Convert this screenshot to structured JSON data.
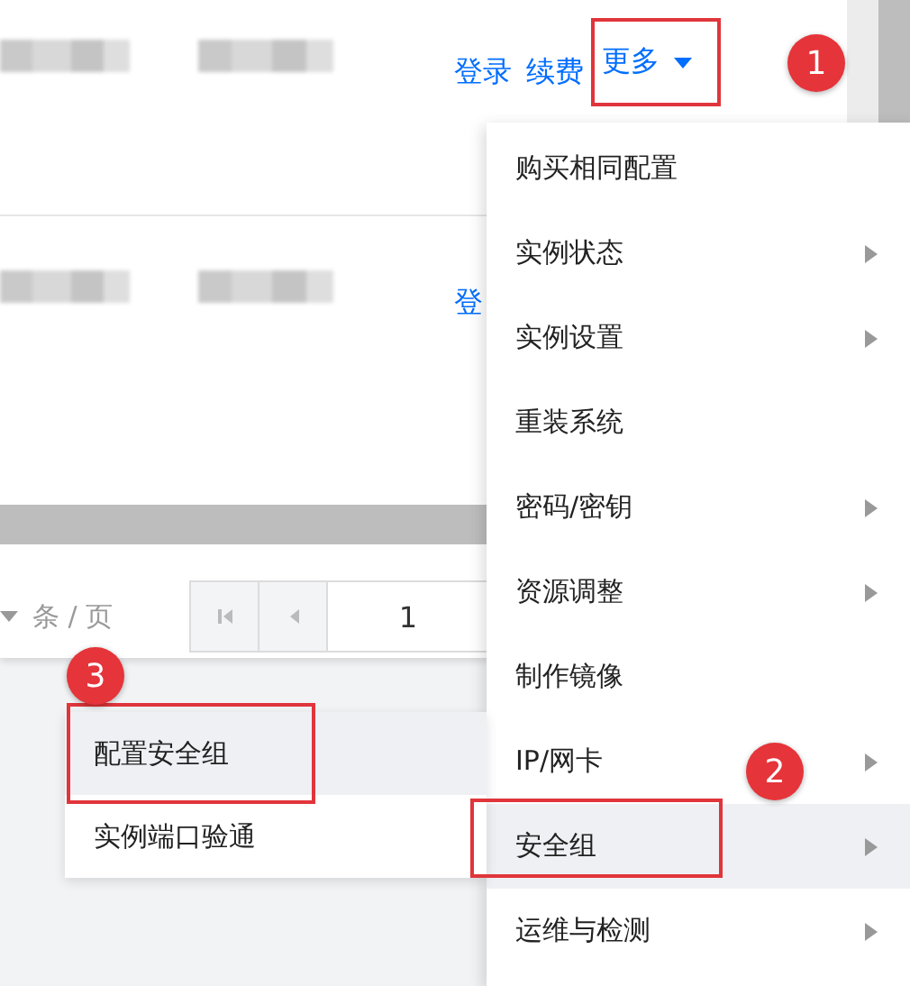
{
  "table": {
    "rows": [
      {
        "actions": [
          {
            "label": "登录"
          },
          {
            "label": "续费"
          }
        ],
        "more": {
          "label": "更多",
          "highlighted": true
        }
      },
      {
        "actions": [
          {
            "label": "登"
          }
        ]
      }
    ]
  },
  "pagination": {
    "page_size_label": "条 / 页",
    "page": "1"
  },
  "menu": {
    "items": [
      {
        "label": "购买相同配置",
        "submenu": false,
        "selected": false,
        "highlighted": false
      },
      {
        "label": "实例状态",
        "submenu": true,
        "selected": false,
        "highlighted": false
      },
      {
        "label": "实例设置",
        "submenu": true,
        "selected": false,
        "highlighted": false
      },
      {
        "label": "重装系统",
        "submenu": false,
        "selected": false,
        "highlighted": false
      },
      {
        "label": "密码/密钥",
        "submenu": true,
        "selected": false,
        "highlighted": false
      },
      {
        "label": "资源调整",
        "submenu": true,
        "selected": false,
        "highlighted": false
      },
      {
        "label": "制作镜像",
        "submenu": false,
        "selected": false,
        "highlighted": false
      },
      {
        "label": "IP/网卡",
        "submenu": true,
        "selected": false,
        "highlighted": false
      },
      {
        "label": "安全组",
        "submenu": true,
        "selected": true,
        "highlighted": true
      },
      {
        "label": "运维与检测",
        "submenu": true,
        "selected": false,
        "highlighted": false
      }
    ]
  },
  "submenu": {
    "items": [
      {
        "label": "配置安全组",
        "selected": true,
        "highlighted": true
      },
      {
        "label": "实例端口验通",
        "selected": false,
        "highlighted": false
      }
    ]
  },
  "step_badges": [
    "1",
    "2",
    "3"
  ]
}
